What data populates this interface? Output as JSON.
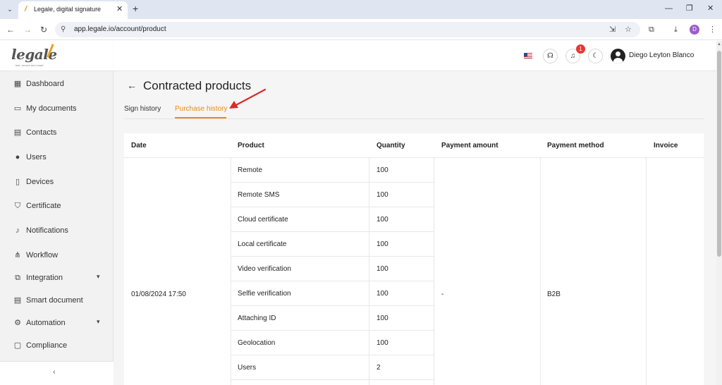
{
  "browser": {
    "tab_title": "Legale, digital signature",
    "url": "app.legale.io/account/product",
    "profile_initial": "D"
  },
  "logo": {
    "text": "legale",
    "tagline": "fast, secure and smart"
  },
  "sidebar": {
    "items": [
      {
        "label": "Dashboard",
        "icon": "dashboard-icon"
      },
      {
        "label": "My documents",
        "icon": "folder-icon"
      },
      {
        "label": "Contacts",
        "icon": "contacts-icon"
      },
      {
        "label": "Users",
        "icon": "user-icon"
      },
      {
        "label": "Devices",
        "icon": "device-icon"
      },
      {
        "label": "Certificate",
        "icon": "shield-icon"
      },
      {
        "label": "Notifications",
        "icon": "bell-icon"
      },
      {
        "label": "Workflow",
        "icon": "workflow-icon"
      },
      {
        "label": "Integration",
        "icon": "link-icon"
      },
      {
        "label": "Smart document",
        "icon": "smart-document-icon"
      },
      {
        "label": "Automation",
        "icon": "automation-icon"
      },
      {
        "label": "Compliance",
        "icon": "compliance-icon"
      }
    ]
  },
  "header": {
    "notification_count": "1",
    "user_name": "Diego Leyton Blanco"
  },
  "page": {
    "title": "Contracted products",
    "tabs": [
      {
        "label": "Sign history",
        "active": false
      },
      {
        "label": "Purchase history",
        "active": true
      }
    ],
    "accent_color": "#e88d14"
  },
  "table": {
    "columns": [
      "Date",
      "Product",
      "Quantity",
      "Payment amount",
      "Payment method",
      "Invoice"
    ],
    "date": "01/08/2024 17:50",
    "payment_amount": "-",
    "payment_method": "B2B",
    "invoice": "",
    "rows": [
      {
        "product": "Remote",
        "quantity": "100"
      },
      {
        "product": "Remote SMS",
        "quantity": "100"
      },
      {
        "product": "Cloud certificate",
        "quantity": "100"
      },
      {
        "product": "Local certificate",
        "quantity": "100"
      },
      {
        "product": "Video verification",
        "quantity": "100"
      },
      {
        "product": "Selfie verification",
        "quantity": "100"
      },
      {
        "product": "Attaching ID",
        "quantity": "100"
      },
      {
        "product": "Geolocation",
        "quantity": "100"
      },
      {
        "product": "Users",
        "quantity": "2"
      }
    ]
  }
}
